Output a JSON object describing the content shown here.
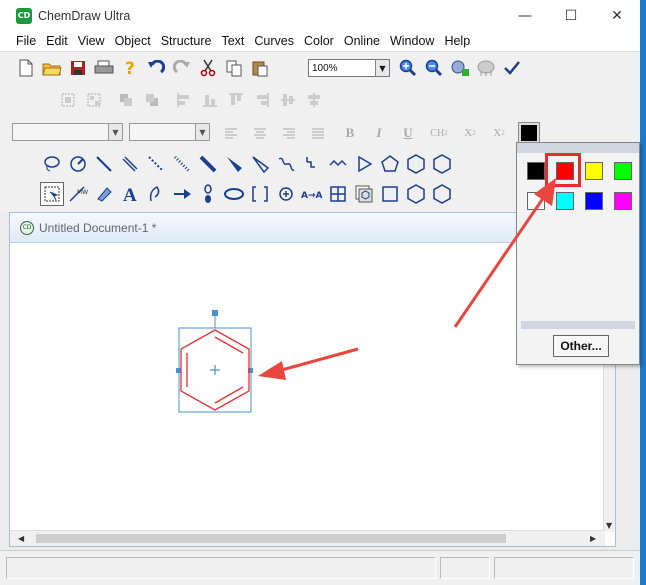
{
  "app": {
    "title": "ChemDraw Ultra",
    "icon_text": "CD"
  },
  "window_controls": [
    "minimize-icon",
    "maximize-icon",
    "close-icon"
  ],
  "menu": {
    "items": [
      "File",
      "Edit",
      "View",
      "Object",
      "Structure",
      "Text",
      "Curves",
      "Color",
      "Online",
      "Window",
      "Help"
    ]
  },
  "toolbar": {
    "zoom_value": "100%",
    "text_format_labels": {
      "bold": "B",
      "italic": "I",
      "underline": "U",
      "ch2": "CH",
      "x2_sub": "X",
      "x2_sup": "X",
      "sub2": "2"
    }
  },
  "document": {
    "title": "Untitled Document-1 *"
  },
  "color_popup": {
    "swatches": [
      {
        "name": "black",
        "hex": "#000000"
      },
      {
        "name": "red",
        "hex": "#ff0000"
      },
      {
        "name": "yellow",
        "hex": "#ffff00"
      },
      {
        "name": "green",
        "hex": "#00ff00"
      },
      {
        "name": "white",
        "hex": "#ffffff"
      },
      {
        "name": "cyan",
        "hex": "#00ffff"
      },
      {
        "name": "blue",
        "hex": "#0000ff"
      },
      {
        "name": "magenta",
        "hex": "#ff00ff"
      }
    ],
    "selected": "red",
    "other_label": "Other..."
  },
  "colors": {
    "annotation": "#e8463f",
    "selection": "#4a90d9",
    "molecule": "#e83030"
  }
}
